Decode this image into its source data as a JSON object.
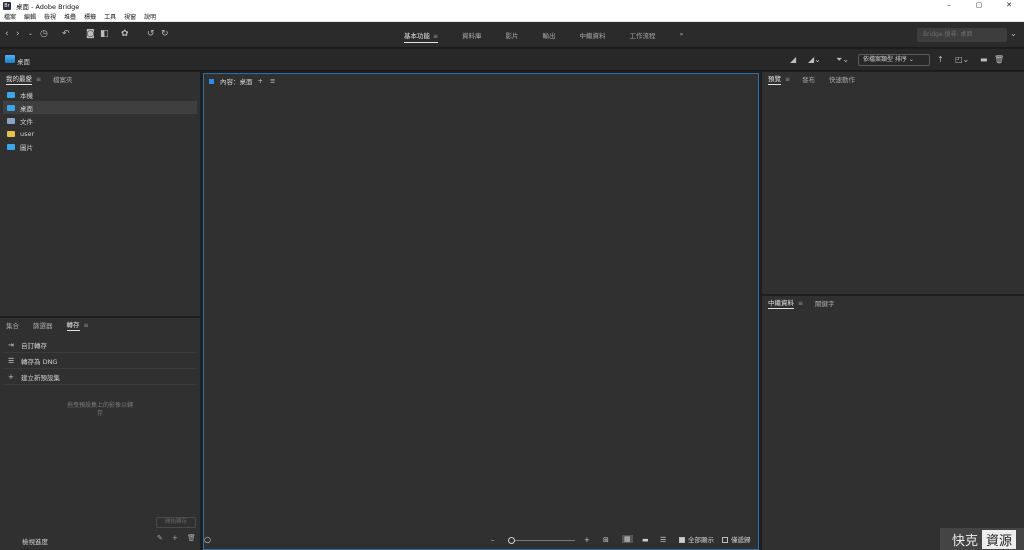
{
  "window": {
    "title": "桌面 - Adobe Bridge",
    "app_badge": "Br",
    "minimize": "–",
    "maximize": "▢",
    "close": "✕"
  },
  "menu": [
    "檔案",
    "編輯",
    "檢視",
    "堆疊",
    "標籤",
    "工具",
    "視窗",
    "說明"
  ],
  "toolbar": {
    "workspaces": [
      {
        "label": "基本功能",
        "active": true,
        "menu": "≡"
      },
      {
        "label": "資料庫",
        "active": false
      },
      {
        "label": "影片",
        "active": false
      },
      {
        "label": "輸出",
        "active": false
      },
      {
        "label": "中繼資料",
        "active": false
      },
      {
        "label": "工作流程",
        "active": false
      }
    ],
    "more": "»",
    "search_placeholder": "Bridge 搜尋: 桌面"
  },
  "pathbar": {
    "path": "桌面",
    "sort_label": "依檔案類型 排序",
    "sort_arrow": "⌄",
    "sort_dir": "↑"
  },
  "favorites_panel": {
    "tabs": [
      {
        "label": "我的最愛",
        "active": true,
        "menu": "≡"
      },
      {
        "label": "檔案夾",
        "active": false
      }
    ],
    "items": [
      {
        "label": "本機",
        "icon": "computer-icon",
        "color": "#3ba7e8",
        "selected": false
      },
      {
        "label": "桌面",
        "icon": "desktop-icon",
        "color": "#3ba7e8",
        "selected": true
      },
      {
        "label": "文件",
        "icon": "documents-icon",
        "color": "#8aa4c4",
        "selected": false
      },
      {
        "label": "user",
        "icon": "folder-icon",
        "color": "#e8c04b",
        "selected": false
      },
      {
        "label": "圖片",
        "icon": "pictures-icon",
        "color": "#3ba7e8",
        "selected": false
      }
    ]
  },
  "output_panel": {
    "tabs": [
      {
        "label": "集合",
        "active": false
      },
      {
        "label": "篩選器",
        "active": false
      },
      {
        "label": "轉存",
        "active": true,
        "menu": "≡"
      }
    ],
    "items": [
      {
        "label": "自訂轉存",
        "icon": "export-icon",
        "glyph": "⇥"
      },
      {
        "label": "轉存為 DNG",
        "icon": "list-icon",
        "glyph": "☰"
      },
      {
        "label": "建立新預設集",
        "icon": "plus-icon",
        "glyph": "+"
      }
    ],
    "drag_hint_line1": "拖曳預設集上的影像以轉",
    "drag_hint_line2": "存",
    "export_button": "開始轉存",
    "queue_label": "檢視進度"
  },
  "content_panel": {
    "title": "內容：桌面",
    "add": "+",
    "menu": "≡",
    "show_all": "全部顯示",
    "show_all_checked": true,
    "recursive": "僅遞歸",
    "recursive_checked": false,
    "zoom_level": 0.0
  },
  "preview_panel": {
    "tabs": [
      {
        "label": "預覽",
        "active": true,
        "menu": "≡"
      },
      {
        "label": "發布",
        "active": false
      },
      {
        "label": "快速動作",
        "active": false
      }
    ]
  },
  "metadata_panel": {
    "tabs": [
      {
        "label": "中繼資料",
        "active": true,
        "menu": "≡"
      },
      {
        "label": "關鍵字",
        "active": false
      }
    ]
  },
  "watermark": {
    "part1": "快克",
    "part2": "資源"
  }
}
